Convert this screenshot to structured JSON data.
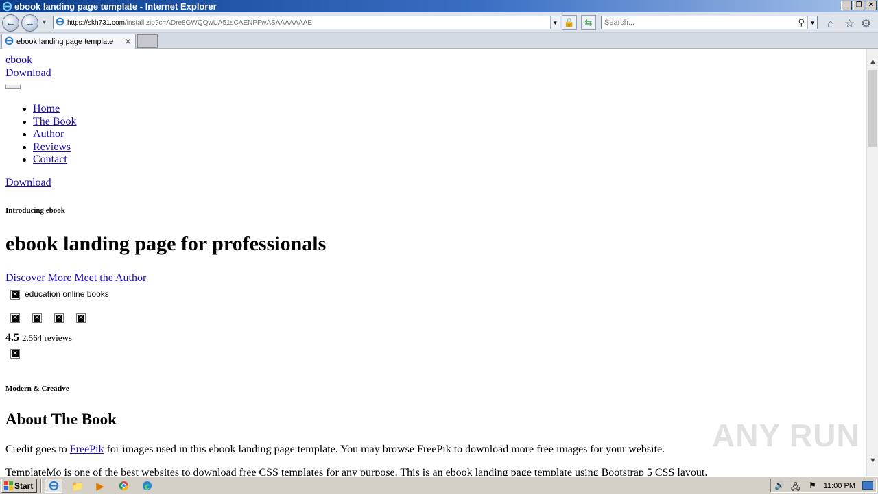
{
  "window": {
    "title": "ebook landing page template - Internet Explorer",
    "controls": [
      "_",
      "❐",
      "✕"
    ]
  },
  "navbar": {
    "url_host": "https://skh731.com",
    "url_rest": "/install.zip?c=ADre8GWQQwUA51sCAENPFwASAAAAAAAE",
    "search_placeholder": "Search..."
  },
  "tabs": [
    {
      "label": "ebook landing page template",
      "active": true
    }
  ],
  "page": {
    "brand": "ebook",
    "top_download": "Download",
    "menu_items": [
      "Home",
      "The Book",
      "Author",
      "Reviews",
      "Contact"
    ],
    "nav_download": "Download",
    "intro_tag": "Introducing ebook",
    "headline": "ebook landing page for professionals",
    "cta_primary": "Discover More",
    "cta_secondary": "Meet the Author",
    "hero_image_alt": "education online books",
    "rating_value": "4.5",
    "review_count": "2,564 reviews",
    "section_tag": "Modern & Creative",
    "section_title": "About The Book",
    "credit_before": "Credit goes to ",
    "credit_link": "FreePik",
    "credit_after": " for images used in this ebook landing page template. You may browse FreePik to download more free images for your website.",
    "next_paragraph": "TemplateMo is one of the best websites to download free CSS templates for any purpose. This is an ebook landing page template using Bootstrap 5 CSS layout."
  },
  "watermark": "ANY RUN",
  "taskbar": {
    "start_label": "Start",
    "clock": "11:00 PM"
  },
  "colors": {
    "link": "#1a0dab",
    "titlebar": "#0b3e8c"
  }
}
